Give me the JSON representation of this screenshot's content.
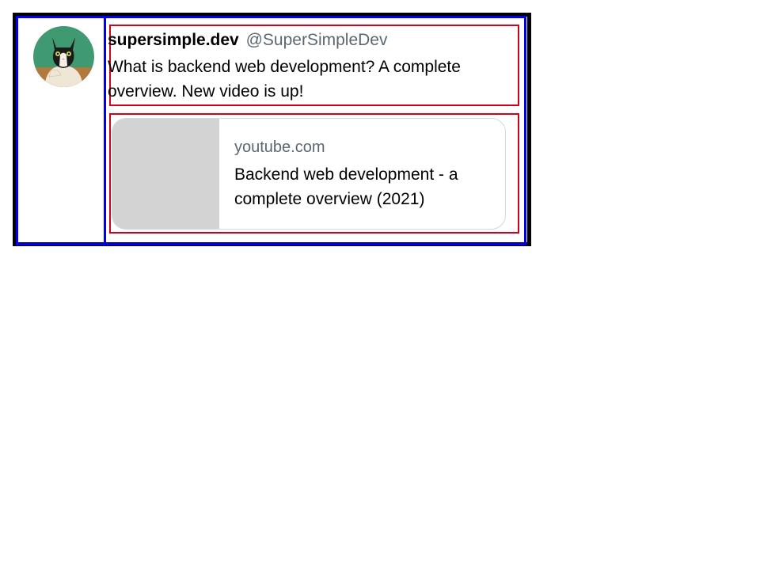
{
  "tweet": {
    "author_name": "supersimple.dev",
    "author_handle": "@SuperSimpleDev",
    "text": "What is backend web development? A complete overview. New video is up!",
    "avatar": {
      "icon": "cat-avatar-icon"
    }
  },
  "link_card": {
    "domain": "youtube.com",
    "title": "Backend web development - a complete overview (2021)"
  },
  "colors": {
    "outer_border": "#000000",
    "column_outline": "#0000ee",
    "section_outline": "#d0021b",
    "muted_text": "#5b6770",
    "thumbnail": "#d3d3d3",
    "avatar_bg": "#3f9a72"
  }
}
